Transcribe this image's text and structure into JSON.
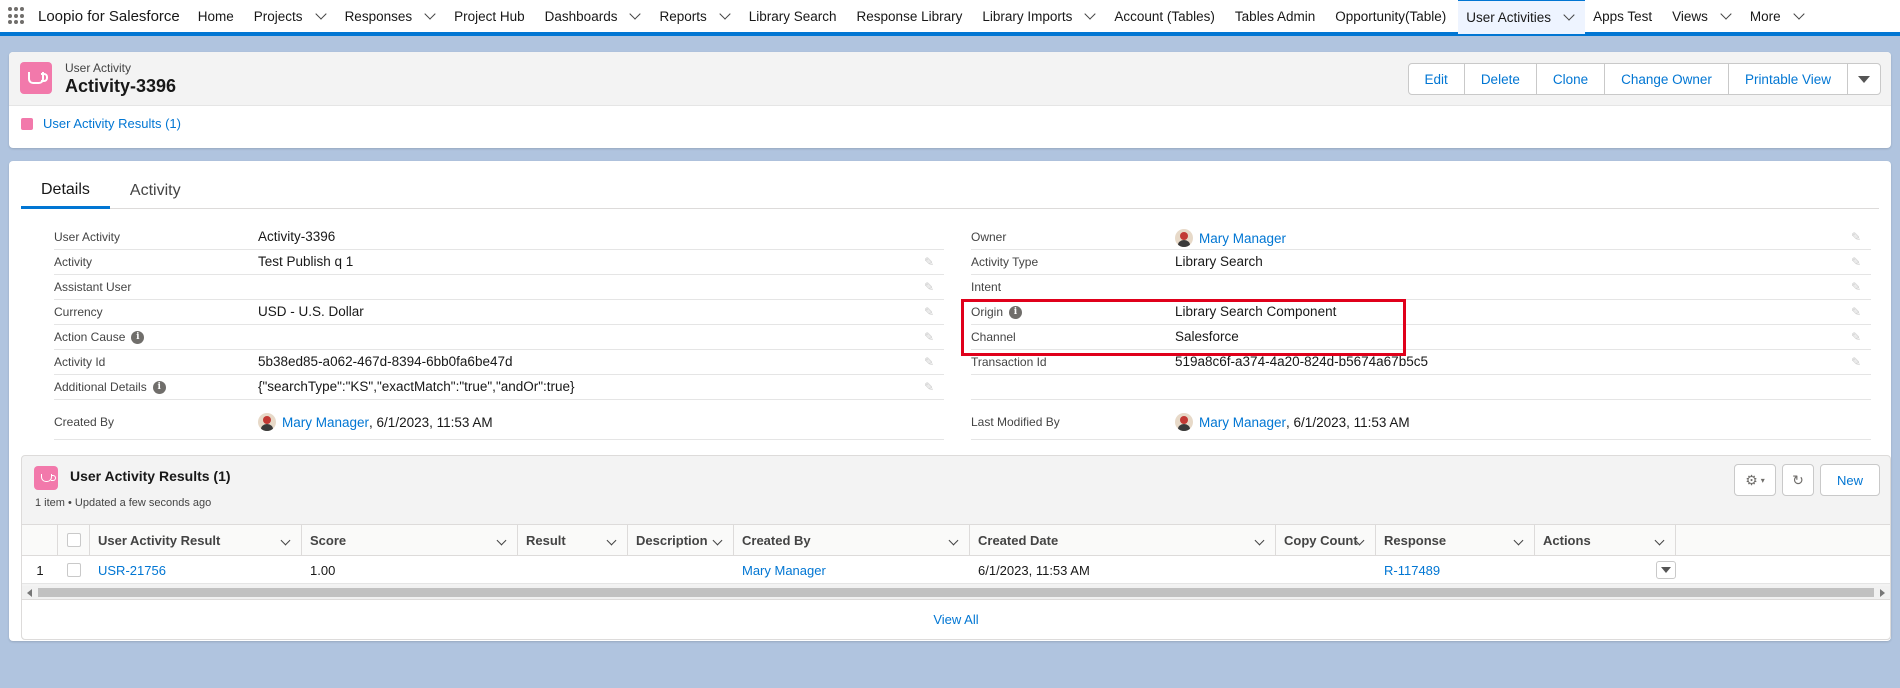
{
  "nav": {
    "app_name": "Loopio for Salesforce",
    "items": [
      {
        "label": "Home",
        "chevron": false
      },
      {
        "label": "Projects",
        "chevron": true
      },
      {
        "label": "Responses",
        "chevron": true
      },
      {
        "label": "Project Hub",
        "chevron": false
      },
      {
        "label": "Dashboards",
        "chevron": true
      },
      {
        "label": "Reports",
        "chevron": true
      },
      {
        "label": "Library Search",
        "chevron": false
      },
      {
        "label": "Response Library",
        "chevron": false
      },
      {
        "label": "Library Imports",
        "chevron": true
      },
      {
        "label": "Account (Tables)",
        "chevron": false
      },
      {
        "label": "Tables Admin",
        "chevron": false
      },
      {
        "label": "Opportunity(Table)",
        "chevron": false
      },
      {
        "label": "User Activities",
        "chevron": true,
        "active": true
      },
      {
        "label": "Apps Test",
        "chevron": false
      },
      {
        "label": "Views",
        "chevron": true
      },
      {
        "label": "More",
        "chevron": true
      }
    ]
  },
  "header": {
    "object_label": "User Activity",
    "record_title": "Activity-3396",
    "buttons": [
      "Edit",
      "Delete",
      "Clone",
      "Change Owner",
      "Printable View"
    ],
    "related_link": "User Activity Results (1)"
  },
  "tabs": [
    "Details",
    "Activity"
  ],
  "fields_left": [
    {
      "label": "User Activity",
      "value": "Activity-3396",
      "editable": false
    },
    {
      "label": "Activity",
      "value": "Test Publish q 1",
      "editable": true
    },
    {
      "label": "Assistant User",
      "value": "",
      "editable": true
    },
    {
      "label": "Currency",
      "value": "USD - U.S. Dollar",
      "editable": true
    },
    {
      "label": "Action Cause",
      "value": "",
      "editable": true,
      "info": true
    },
    {
      "label": "Activity Id",
      "value": "5b38ed85-a062-467d-8394-6bb0fa6be47d",
      "editable": true
    },
    {
      "label": "Additional Details",
      "value": "{\"searchType\":\"KS\",\"exactMatch\":\"true\",\"andOr\":true}",
      "editable": true,
      "info": true
    }
  ],
  "fields_right": [
    {
      "label": "Owner",
      "value": "Mary Manager",
      "editable": true,
      "link": true,
      "avatar": true
    },
    {
      "label": "Activity Type",
      "value": "Library Search",
      "editable": true
    },
    {
      "label": "Intent",
      "value": "",
      "editable": true
    },
    {
      "label": "Origin",
      "value": "Library Search Component",
      "editable": true,
      "info": true
    },
    {
      "label": "Channel",
      "value": "Salesforce",
      "editable": true
    },
    {
      "label": "Transaction Id",
      "value": "519a8c6f-a374-4a20-824d-b5674a67b5c5",
      "editable": true
    },
    {
      "label": "",
      "value": "",
      "editable": false
    }
  ],
  "created_by": {
    "label": "Created By",
    "name": "Mary Manager",
    "date": ", 6/1/2023, 11:53 AM"
  },
  "last_modified": {
    "label": "Last Modified By",
    "name": "Mary Manager",
    "date": ", 6/1/2023, 11:53 AM"
  },
  "related_list": {
    "title": "User Activity Results (1)",
    "subtitle": "1 item • Updated a few seconds ago",
    "new_label": "New",
    "columns": [
      "User Activity Result",
      "Score",
      "Result",
      "Description",
      "Created By",
      "Created Date",
      "Copy Count",
      "Response",
      "Actions"
    ],
    "rows": [
      {
        "num": "1",
        "result": "USR-21756",
        "score": "1.00",
        "res": "",
        "desc": "",
        "created_by": "Mary Manager",
        "created_date": "6/1/2023, 11:53 AM",
        "copy_count": "",
        "response": "R-117489"
      }
    ],
    "view_all": "View All"
  }
}
